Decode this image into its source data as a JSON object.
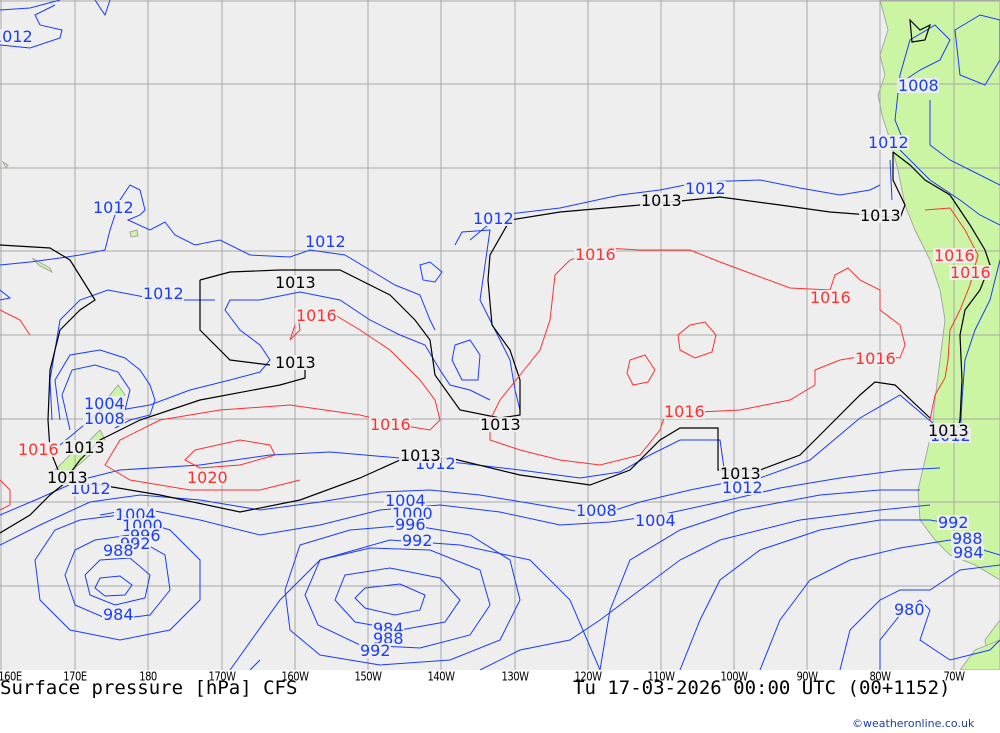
{
  "map": {
    "title": "Surface pressure [hPa] CFS",
    "valid_time": "Tu 17-03-2026 00:00 UTC (00+1152)",
    "credit": "©weatheronline.co.uk",
    "longitude_ticks": [
      "160E",
      "170E",
      "180",
      "170W",
      "160W",
      "150W",
      "140W",
      "130W",
      "120W",
      "110W",
      "100W",
      "90W",
      "80W",
      "70W"
    ],
    "colors": {
      "sea": "#eeeeee",
      "land": "#ccf5a3",
      "grid": "#a8a8a8",
      "low_isobar": "#1a3cff",
      "ref_isobar": "#000000",
      "high_isobar": "#ff3030"
    },
    "isobar_labels": {
      "blue": [
        "1012",
        "1008",
        "1012",
        "1012",
        "1012",
        "1012",
        "1012",
        "1012",
        "1004",
        "1008",
        "1012",
        "1012",
        "1012",
        "1008",
        "1004",
        "1004",
        "1000",
        "996",
        "992",
        "1004",
        "1000",
        "996",
        "992",
        "988",
        "984",
        "984",
        "988",
        "992",
        "980",
        "992",
        "988",
        "984",
        "1012"
      ],
      "black": [
        "1013",
        "1013",
        "1013",
        "1013",
        "1013",
        "1013",
        "1013",
        "1013",
        "1013",
        "1013"
      ],
      "red": [
        "1016",
        "1016",
        "1016",
        "1016",
        "1016",
        "1016",
        "1016",
        "1016",
        "1016",
        "1020"
      ]
    }
  }
}
